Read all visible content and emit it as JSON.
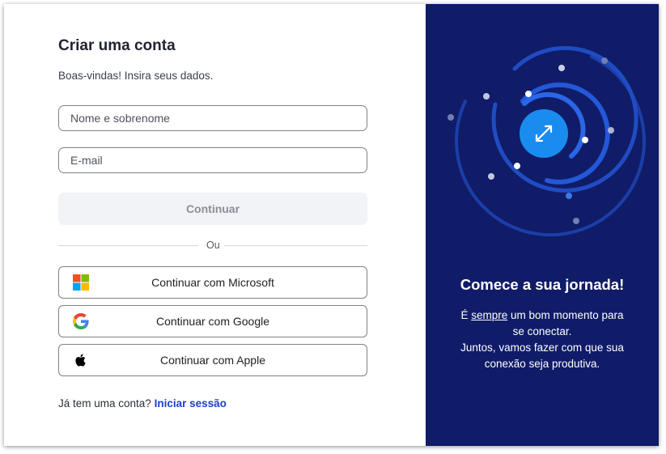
{
  "form": {
    "title": "Criar uma conta",
    "subtitle": "Boas-vindas! Insira seus dados.",
    "name_placeholder": "Nome e sobrenome",
    "email_placeholder": "E-mail",
    "continue_label": "Continuar",
    "divider_text": "Ou"
  },
  "social": {
    "microsoft_label": "Continuar com Microsoft",
    "google_label": "Continuar com Google",
    "apple_label": "Continuar com Apple"
  },
  "footer": {
    "prompt": "Já tem uma conta?",
    "login_link": "Iniciar sessão"
  },
  "promo": {
    "headline": "Comece a sua jornada!",
    "line1_prefix": "É ",
    "line1_emphasis": "sempre",
    "line1_suffix": " um bom momento para",
    "line2": "se conectar.",
    "line3": "Juntos, vamos fazer com que sua",
    "line4": "conexão seja produtiva."
  },
  "colors": {
    "brand_panel": "#101c68",
    "accent_blue": "#1a8cf0",
    "link": "#1d3fd1"
  },
  "icons": {
    "center_badge": "expand-arrows-icon",
    "microsoft": "microsoft-logo-icon",
    "google": "google-logo-icon",
    "apple": "apple-logo-icon"
  }
}
